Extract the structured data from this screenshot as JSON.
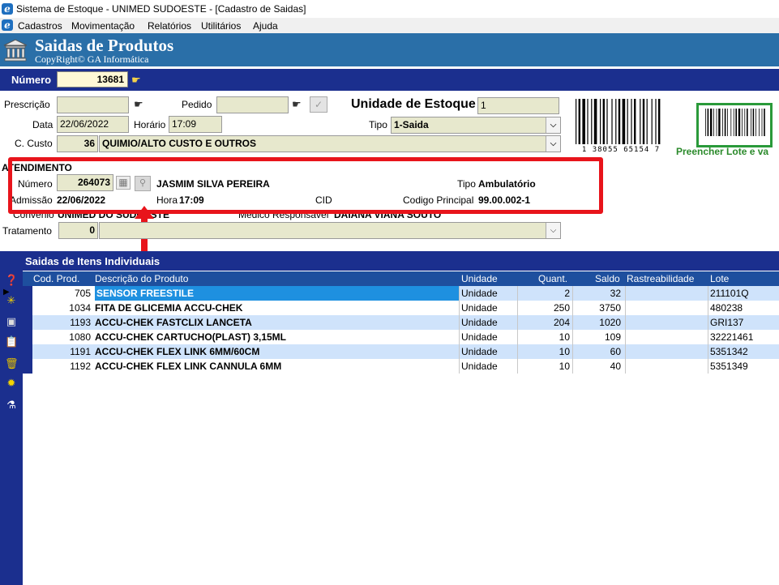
{
  "window": {
    "title": "Sistema de Estoque - UNIMED SUDOESTE - [Cadastro de Saidas]",
    "icon": "ie-app-icon"
  },
  "menu": [
    "Cadastros",
    "Movimentação",
    "Relatórios",
    "Utilitários",
    "Ajuda"
  ],
  "banner": {
    "title": "Saidas de Produtos",
    "subtitle": "CopyRight© GA Informática",
    "icon": "bank-icon"
  },
  "numero": {
    "label": "Número",
    "value": "13681"
  },
  "form": {
    "prescricao_label": "Prescrição",
    "prescricao_value": "",
    "pedido_label": "Pedido",
    "pedido_value": "",
    "unidade_estoque_label": "Unidade de Estoque",
    "unidade_estoque_value": "1",
    "data_label": "Data",
    "data_value": "22/06/2022",
    "horario_label": "Horário",
    "horario_value": "17:09",
    "tipo_label": "Tipo",
    "tipo_value": "1-Saida",
    "custo_label": "C. Custo",
    "custo_code": "36",
    "custo_desc": "QUIMIO/ALTO CUSTO E OUTROS",
    "barcode_digits": "1 38055 65154 7",
    "green_hint": "Preencher Lote e va"
  },
  "atendimento": {
    "section_label": "ATENDIMENTO",
    "numero_label": "Número",
    "numero_value": "264073",
    "patient_name": "JASMIM SILVA PEREIRA",
    "tipo_label": "Tipo",
    "tipo_value": "Ambulatório",
    "admissao_label": "Admissão",
    "admissao_value": "22/06/2022",
    "hora_label": "Hora",
    "hora_value": "17:09",
    "cid_label": "CID",
    "codigo_label": "Codigo Principal",
    "codigo_value": "99.00.002-1",
    "convenio_label": "Convenio",
    "convenio_value": "UNIMED DO SUDOESTE",
    "medico_label": "Medico Responsavel",
    "medico_value": "DAIANA VIANA SOUTO"
  },
  "tratamento": {
    "label": "Tratamento",
    "code": "0",
    "desc": ""
  },
  "grid": {
    "title": "Saidas de Itens Individuais",
    "columns": [
      "Cod. Prod.",
      "Descrição do Produto",
      "Unidade",
      "Quant.",
      "Saldo",
      "Rastreabilidade",
      "Lote"
    ],
    "rows": [
      {
        "cod": "705",
        "desc": "SENSOR FREESTILE",
        "unidade": "Unidade",
        "quant": "2",
        "saldo": "32",
        "rastreabilidade": "",
        "lote": "211101Q"
      },
      {
        "cod": "1034",
        "desc": "FITA DE GLICEMIA ACCU-CHEK",
        "unidade": "Unidade",
        "quant": "250",
        "saldo": "3750",
        "rastreabilidade": "",
        "lote": "480238"
      },
      {
        "cod": "1193",
        "desc": "ACCU-CHEK FASTCLIX LANCETA",
        "unidade": "Unidade",
        "quant": "204",
        "saldo": "1020",
        "rastreabilidade": "",
        "lote": "GRI137"
      },
      {
        "cod": "1080",
        "desc": "ACCU-CHEK CARTUCHO(PLAST) 3,15ML",
        "unidade": "Unidade",
        "quant": "10",
        "saldo": "109",
        "rastreabilidade": "",
        "lote": "32221461"
      },
      {
        "cod": "1191",
        "desc": "ACCU-CHEK FLEX LINK 6MM/60CM",
        "unidade": "Unidade",
        "quant": "10",
        "saldo": "60",
        "rastreabilidade": "",
        "lote": "5351342"
      },
      {
        "cod": "1192",
        "desc": "ACCU-CHEK FLEX LINK CANNULA 6MM",
        "unidade": "Unidade",
        "quant": "10",
        "saldo": "40",
        "rastreabilidade": "",
        "lote": "5351349"
      }
    ]
  },
  "toolbar_icons": [
    "help-icon",
    "new-icon",
    "save-icon",
    "clipboard-icon",
    "delete-icon",
    "settings-icon",
    "flask-icon"
  ],
  "colors": {
    "banner": "#2a6fa8",
    "navy": "#1b2f8e",
    "field": "#e7e8cd",
    "selected_row": "#1e90e0",
    "alt_row": "#cfe3fb",
    "highlight": "#e8141b",
    "green": "#2a9a3a"
  }
}
